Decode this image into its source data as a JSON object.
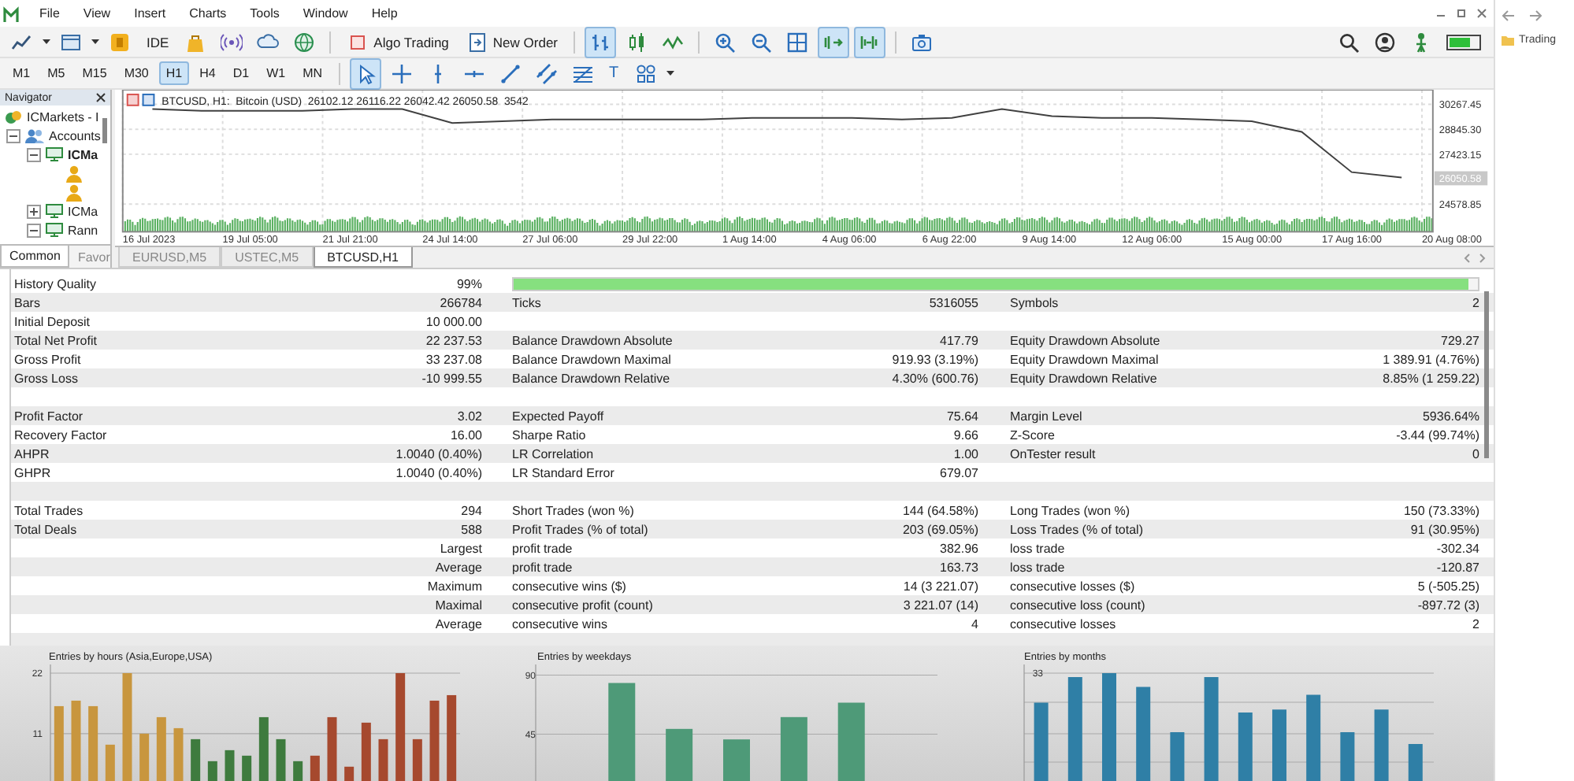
{
  "menu": [
    "File",
    "View",
    "Insert",
    "Charts",
    "Tools",
    "Window",
    "Help"
  ],
  "toolbar": {
    "ide": "IDE",
    "algo_trading": "Algo Trading",
    "new_order": "New Order",
    "chart_modes": [
      {
        "selected": true
      },
      {
        "selected": false
      },
      {
        "selected": false
      }
    ],
    "scroll_modes": [
      {
        "selected": true
      },
      {
        "selected": true
      }
    ]
  },
  "timeframes": [
    {
      "label": "M1",
      "selected": false
    },
    {
      "label": "M5",
      "selected": false
    },
    {
      "label": "M15",
      "selected": false
    },
    {
      "label": "M30",
      "selected": false
    },
    {
      "label": "H1",
      "selected": true
    },
    {
      "label": "H4",
      "selected": false
    },
    {
      "label": "D1",
      "selected": false
    },
    {
      "label": "W1",
      "selected": false
    },
    {
      "label": "MN",
      "selected": false
    }
  ],
  "drawing_tools": [
    {
      "kind": "cursor",
      "selected": true
    },
    {
      "kind": "crosshair",
      "selected": false
    },
    {
      "kind": "vline",
      "selected": false
    },
    {
      "kind": "hline",
      "selected": false
    },
    {
      "kind": "trend",
      "selected": false
    },
    {
      "kind": "channel",
      "selected": false
    },
    {
      "kind": "fibo",
      "selected": false
    },
    {
      "kind": "text",
      "label": "T",
      "selected": false
    },
    {
      "kind": "shapes",
      "selected": false
    }
  ],
  "navigator": {
    "title": "Navigator",
    "tree": [
      {
        "kind": "broker",
        "label": "ICMarkets - I",
        "children": [
          {
            "kind": "accounts",
            "label": "Accounts",
            "expanded": true,
            "children": [
              {
                "kind": "server",
                "label": "ICMa",
                "expanded": true,
                "current": true,
                "children": [
                  {
                    "kind": "user"
                  },
                  {
                    "kind": "user"
                  }
                ]
              },
              {
                "kind": "server",
                "label": "ICMa",
                "expanded": false,
                "current": false
              },
              {
                "kind": "server",
                "label": "Rann",
                "expanded": true,
                "current": false
              }
            ]
          }
        ]
      }
    ],
    "tabs": [
      {
        "label": "Common",
        "selected": true
      },
      {
        "label": "Favor",
        "selected": false
      }
    ]
  },
  "chart": {
    "price_label": "26050.58",
    "chart_data": {
      "type": "line",
      "title": "BTCUSD, H1:  Bitcoin (USD)  26102.12 26116.22 26042.42 26050.58  3542",
      "categories": [
        "16 Jul 2023",
        null,
        "19 Jul 05:00",
        null,
        "21 Jul 21:00",
        null,
        "24 Jul 14:00",
        null,
        "27 Jul 06:00",
        null,
        "29 Jul 22:00",
        null,
        "1 Aug 14:00",
        null,
        "4 Aug 06:00",
        null,
        "6 Aug 22:00",
        null,
        "9 Aug 14:00",
        null,
        "12 Aug 06:00",
        null,
        "15 Aug 00:00",
        null,
        "17 Aug 16:00",
        null,
        "20 Aug 08:00"
      ],
      "series": [
        {
          "color": "#404040",
          "values": [
            30000,
            29900,
            29900,
            29900,
            30000,
            30000,
            29200,
            29300,
            29400,
            29400,
            29400,
            29400,
            29500,
            29500,
            29500,
            29400,
            29500,
            30000,
            29600,
            29500,
            29500,
            29400,
            29300,
            28700,
            26400,
            26100,
            null
          ]
        }
      ],
      "ylim": [
        23000,
        31100
      ],
      "grid": true,
      "yticks": [
        {
          "value": 30267.45,
          "label": "30267.45"
        },
        {
          "value": 28845.3,
          "label": "28845.30"
        },
        {
          "value": 27423.15,
          "label": "27423.15"
        },
        {
          "value": 24578.85,
          "label": "24578.85"
        }
      ]
    },
    "tabs": [
      {
        "label": "EURUSD,M5",
        "selected": false
      },
      {
        "label": "USTEC,M5",
        "selected": false
      },
      {
        "label": "BTCUSD,H1",
        "selected": true
      }
    ]
  },
  "report": [
    {
      "kind": "quality",
      "name": "History Quality",
      "value": "99%",
      "level": 0.99
    },
    {
      "name": "Bars",
      "value": "266784",
      "name_2": "Ticks",
      "value_2": "5316055",
      "name_3": "Symbols",
      "value_3": "2"
    },
    {
      "name": "Initial Deposit",
      "value": "10 000.00"
    },
    {
      "name": "Total Net Profit",
      "value": "22 237.53",
      "name_2": "Balance Drawdown Absolute",
      "value_2": "417.79",
      "name_3": "Equity Drawdown Absolute",
      "value_3": "729.27"
    },
    {
      "name": "Gross Profit",
      "value": "33 237.08",
      "name_2": "Balance Drawdown Maximal",
      "value_2": "919.93 (3.19%)",
      "name_3": "Equity Drawdown Maximal",
      "value_3": "1 389.91 (4.76%)"
    },
    {
      "name": "Gross Loss",
      "value": "-10 999.55",
      "name_2": "Balance Drawdown Relative",
      "value_2": "4.30% (600.76)",
      "name_3": "Equity Drawdown Relative",
      "value_3": "8.85% (1 259.22)"
    },
    {
      "kind": "blank"
    },
    {
      "name": "Profit Factor",
      "value": "3.02",
      "name_2": "Expected Payoff",
      "value_2": "75.64",
      "name_3": "Margin Level",
      "value_3": "5936.64%"
    },
    {
      "name": "Recovery Factor",
      "value": "16.00",
      "name_2": "Sharpe Ratio",
      "value_2": "9.66",
      "name_3": "Z-Score",
      "value_3": "-3.44 (99.74%)"
    },
    {
      "name": "AHPR",
      "value": "1.0040 (0.40%)",
      "name_2": "LR Correlation",
      "value_2": "1.00",
      "name_3": "OnTester result",
      "value_3": "0"
    },
    {
      "name": "GHPR",
      "value": "1.0040 (0.40%)",
      "name_2": "LR Standard Error",
      "value_2": "679.07"
    },
    {
      "kind": "blank"
    },
    {
      "name": "Total Trades",
      "value": "294",
      "name_2": "Short Trades (won %)",
      "value_2": "144 (64.58%)",
      "name_3": "Long Trades (won %)",
      "value_3": "150 (73.33%)"
    },
    {
      "name": "Total Deals",
      "value": "588",
      "name_2": "Profit Trades (% of total)",
      "value_2": "203 (69.05%)",
      "name_3": "Loss Trades (% of total)",
      "value_3": "91 (30.95%)"
    },
    {
      "value": "Largest",
      "name_2": "profit trade",
      "value_2": "382.96",
      "name_3": "loss trade",
      "value_3": "-302.34"
    },
    {
      "value": "Average",
      "name_2": "profit trade",
      "value_2": "163.73",
      "name_3": "loss trade",
      "value_3": "-120.87"
    },
    {
      "value": "Maximum",
      "name_2": "consecutive wins ($)",
      "value_2": "14 (3 221.07)",
      "name_3": "consecutive losses ($)",
      "value_3": "5 (-505.25)"
    },
    {
      "value": "Maximal",
      "name_2": "consecutive profit (count)",
      "value_2": "3 221.07 (14)",
      "name_3": "consecutive loss (count)",
      "value_3": "-897.72 (3)"
    },
    {
      "value": "Average",
      "name_2": "consecutive wins",
      "value_2": "4",
      "name_3": "consecutive losses",
      "value_3": "2"
    },
    {
      "kind": "blank"
    }
  ],
  "hours_chart": {
    "chart_data": {
      "type": "bar",
      "title": "Entries by hours (Asia,Europe,USA)",
      "series": [
        {
          "color": "#c8963e",
          "values": [
            16,
            17,
            16,
            9,
            22,
            11,
            14,
            12,
            null,
            null,
            null,
            null,
            null,
            null,
            null,
            null,
            null,
            null,
            null,
            null,
            null,
            null,
            null,
            null
          ]
        },
        {
          "color": "#3e7b3e",
          "values": [
            null,
            null,
            null,
            null,
            null,
            null,
            null,
            null,
            10,
            6,
            8,
            7,
            14,
            10,
            6,
            null,
            null,
            null,
            null,
            null,
            null,
            null,
            null,
            null
          ]
        },
        {
          "color": "#a6492e",
          "values": [
            null,
            null,
            null,
            null,
            null,
            null,
            null,
            null,
            null,
            null,
            null,
            null,
            null,
            null,
            null,
            7,
            14,
            5,
            13,
            10,
            22,
            10,
            17,
            18
          ]
        }
      ],
      "ylim": [
        2.4,
        23
      ],
      "yticks": [
        11,
        22
      ]
    }
  },
  "weekdays_chart": {
    "chart_data": {
      "type": "bar",
      "title": "Entries by weekdays",
      "series": [
        {
          "color": "#4e9a78",
          "values": [
            null,
            84,
            49,
            41,
            58,
            69,
            null
          ]
        }
      ],
      "ylim": [
        9.3,
        93
      ],
      "yticks": [
        45,
        90
      ]
    }
  },
  "months_chart": {
    "title": "Entries by months",
    "tick": "33"
  },
  "browser_panel": {
    "bookmark": "Trading"
  }
}
